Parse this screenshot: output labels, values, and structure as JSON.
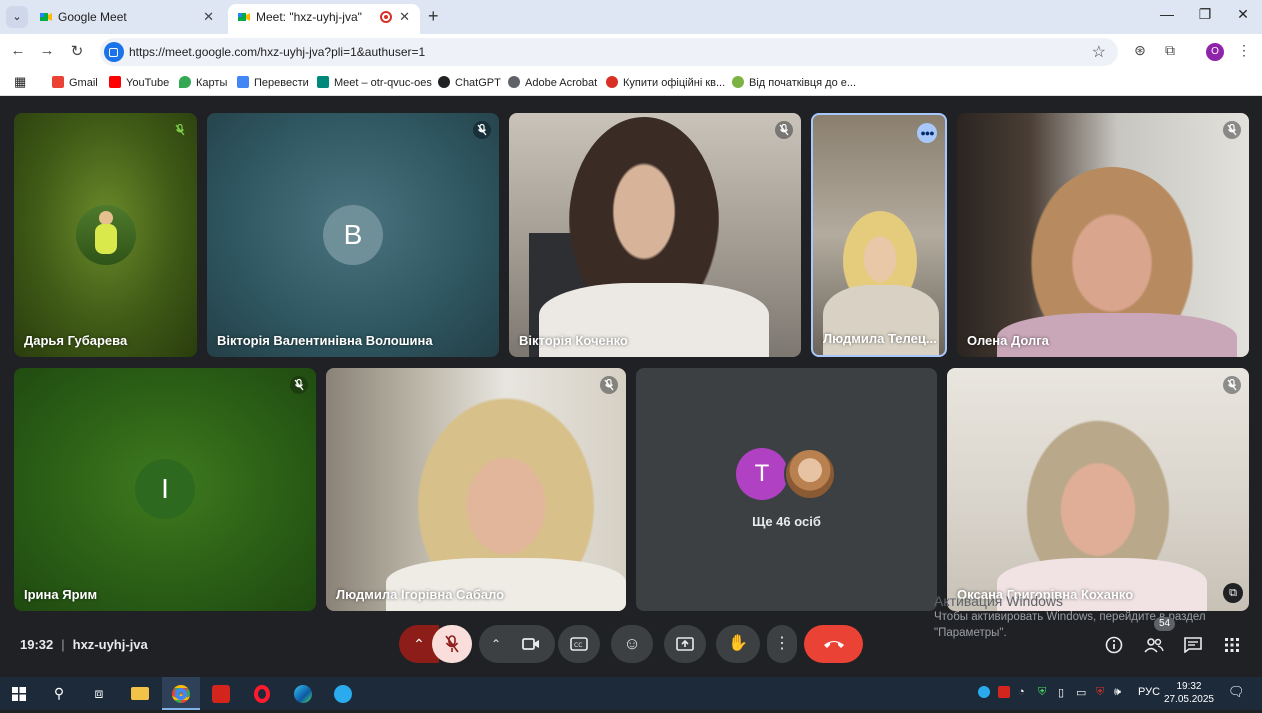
{
  "browser": {
    "tabs": [
      {
        "title": "Google Meet",
        "active": false
      },
      {
        "title": "Meet: \"hxz-uyhj-jva\"",
        "active": true,
        "recording": true
      }
    ],
    "url": "https://meet.google.com/hxz-uyhj-jva?pli=1&authuser=1",
    "profile_initial": "O",
    "bookmarks": [
      {
        "label": "Gmail",
        "icon": "gmail-icon",
        "color": "#ea4335"
      },
      {
        "label": "YouTube",
        "icon": "youtube-icon",
        "color": "#ff0000"
      },
      {
        "label": "Карты",
        "icon": "maps-icon",
        "color": "#34a853"
      },
      {
        "label": "Перевести",
        "icon": "translate-icon",
        "color": "#4285f4"
      },
      {
        "label": "Meet – otr-qvuc-oes",
        "icon": "meet-icon",
        "color": "#00897b"
      },
      {
        "label": "ChatGPT",
        "icon": "chatgpt-icon",
        "color": "#202123"
      },
      {
        "label": "Adobe Acrobat",
        "icon": "acrobat-icon",
        "color": "#5f6368"
      },
      {
        "label": "Купити офіційні кв...",
        "icon": "ticket-icon",
        "color": "#d93025"
      },
      {
        "label": "Від початківця до е...",
        "icon": "course-icon",
        "color": "#7cb342"
      }
    ]
  },
  "participants": [
    {
      "name": "Дарья Губарева",
      "muted": true
    },
    {
      "name": "Вікторія Валентинівна Волошина",
      "muted": true,
      "initial": "B"
    },
    {
      "name": "Вікторія Коченко",
      "muted": true
    },
    {
      "name": "Людмила Телец...",
      "muted": false,
      "speaking": true
    },
    {
      "name": "Олена Долга",
      "muted": true
    },
    {
      "name": "Ірина Ярим",
      "muted": true,
      "initial": "I"
    },
    {
      "name": "Людмила Ігорівна Сабало",
      "muted": true
    },
    {
      "name": "Оксана Григорівна Коханко",
      "muted": true
    }
  ],
  "more_tile": {
    "initial": "T",
    "label": "Ще 46 осіб"
  },
  "meeting": {
    "time": "19:32",
    "code": "hxz-uyhj-jva",
    "people_count": "54"
  },
  "activation": {
    "heading": "Активация Windows",
    "line1": "Чтобы активировать Windows, перейдите в раздел",
    "line2": "\"Параметры\"."
  },
  "taskbar": {
    "language": "РУС",
    "time": "19:32",
    "date": "27.05.2025"
  },
  "colors": {
    "meet_bg": "#202124",
    "end_call": "#ea4335",
    "avatar_t": "#b041c2"
  }
}
